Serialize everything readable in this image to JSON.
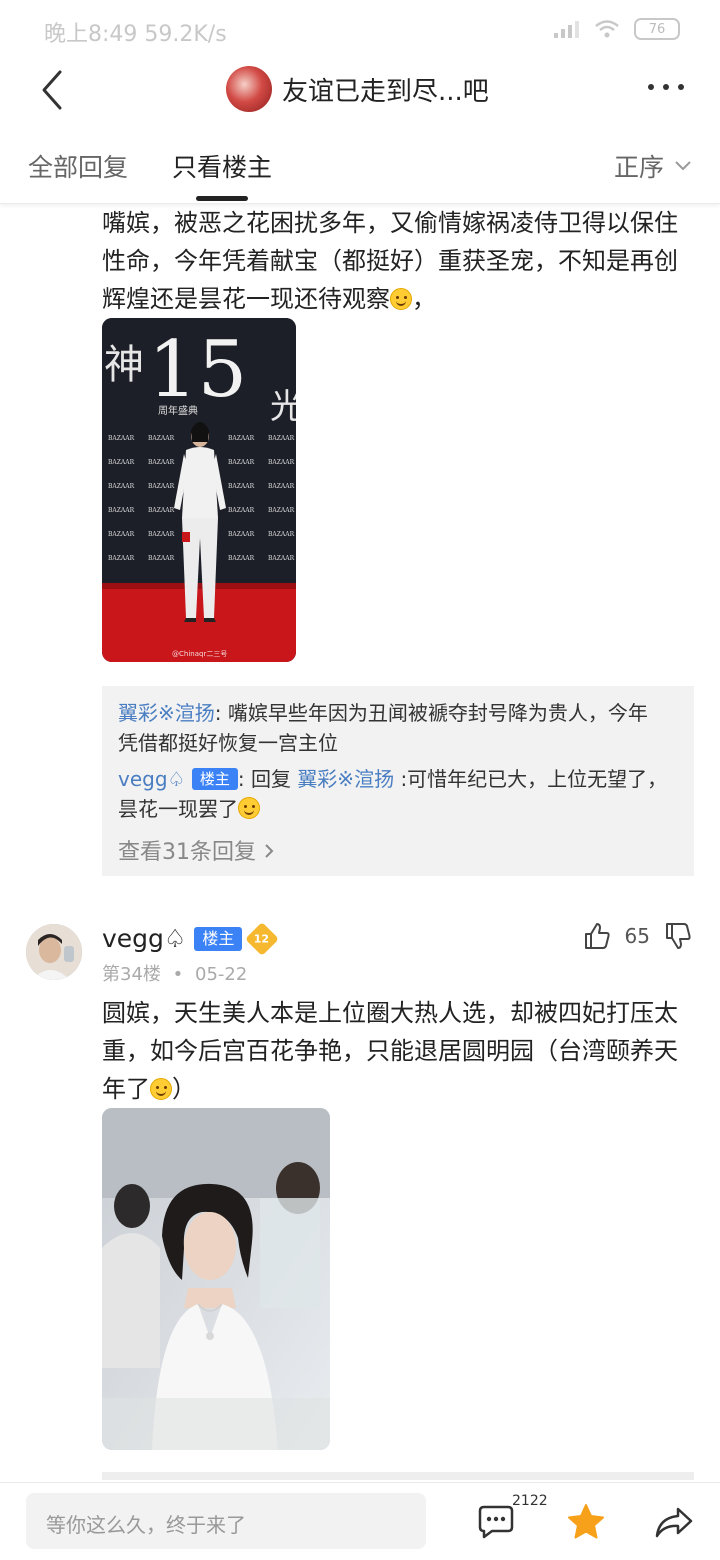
{
  "status_bar": {
    "time_speed": "晚上8:49 59.2K/s",
    "battery": "76"
  },
  "header": {
    "title": "友谊已走到尽...吧"
  },
  "tabs": [
    {
      "label": "全部回复"
    },
    {
      "label": "只看楼主"
    }
  ],
  "sort": {
    "label": "正序"
  },
  "post_prev": {
    "text_lines": [
      "嘴嫔，被恶之花困扰多年，又偷情嫁祸凌侍卫得以保住",
      "性命，今年凭着献宝（都挺好）重获圣宠，不知是再创",
      "辉煌还是昙花一现还待观察"
    ],
    "text_tail": "，",
    "photo": {
      "big_number": "15",
      "sub": "周年盛典",
      "watermark": "@Chinaqr二三号",
      "board_text": "BAZAAR"
    }
  },
  "reply_box": {
    "reply1_user": "翼彩※渲扬",
    "reply1_sep": ":",
    "reply1_text_a": "嘴嫔早些年因为丑闻被褫夺封号降为贵人，今年",
    "reply1_text_b": "凭借都挺好恢复一宫主位",
    "reply2_user": "vegg♤",
    "reply2_badge": "楼主",
    "reply2_sep": ":",
    "reply2_word": "回复",
    "reply2_target": "翼彩※渲扬",
    "reply2_text_a": ":可惜年纪已大，上位无望了，",
    "reply2_text_b": "昙花一现罢了",
    "view_more": "查看31条回复"
  },
  "post": {
    "username": "vegg♤",
    "op_badge": "楼主",
    "level": "12",
    "floor": "第34楼",
    "date": "05-22",
    "likes": "65",
    "text_lines": [
      "圆嫔，天生美人本是上位圈大热人选，却被四妃打压太",
      "重，如今后宫百花争艳，只能退居圆明园（台湾颐养天",
      "年了"
    ],
    "text_tail": "）"
  },
  "bottom_bar": {
    "input_placeholder": "等你这么久，终于来了",
    "comment_count": "2122"
  },
  "colors": {
    "accent_blue": "#3b82f6",
    "link_blue": "#4a7ec2",
    "star": "#f7a01a"
  }
}
